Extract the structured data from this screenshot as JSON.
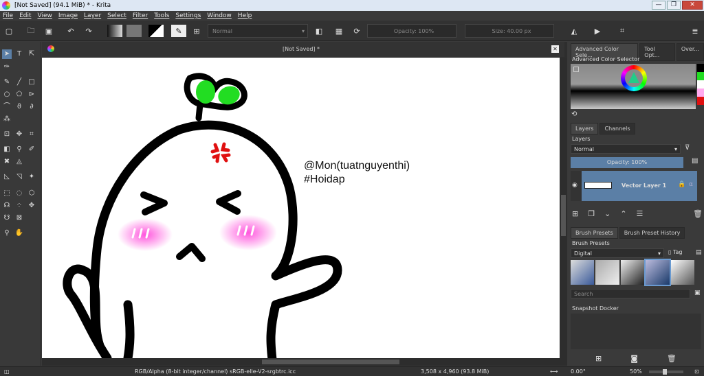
{
  "window": {
    "title": "[Not Saved]  (94.1 MiB)  * - Krita",
    "minimize": "—",
    "restore": "❐",
    "close": "✕"
  },
  "menu": [
    "File",
    "Edit",
    "View",
    "Image",
    "Layer",
    "Select",
    "Filter",
    "Tools",
    "Settings",
    "Window",
    "Help"
  ],
  "toolbar": {
    "blend_mode": "Normal",
    "opacity": "Opacity: 100%",
    "size": "Size: 40.00 px"
  },
  "document": {
    "tab_title": "[Not Saved]  *",
    "close": "✕"
  },
  "canvas": {
    "text_line1": "@Mon(tuatnguyenthi)",
    "text_line2": "#Hoidap"
  },
  "right_dock": {
    "top_tabs": [
      "Advanced Color Sele...",
      "Tool Opt...",
      "Over..."
    ],
    "color_selector_title": "Advanced Color Selector",
    "layers_tabs": [
      "Layers",
      "Channels"
    ],
    "layers_title": "Layers",
    "blend_mode": "Normal",
    "layer_opacity": "Opacity:  100%",
    "layer_name": "Vector Layer 1",
    "preset_tabs": [
      "Brush Presets",
      "Brush Preset History"
    ],
    "presets_title": "Brush Presets",
    "preset_filter": "Digital",
    "tag_label": "Tag",
    "search_placeholder": "Search",
    "snapshot_title": "Snapshot Docker"
  },
  "status": {
    "color_space": "RGB/Alpha (8-bit integer/channel)  sRGB-elle-V2-srgbtrc.icc",
    "dimensions": "3,508 x 4,960 (93.8 MiB)",
    "rotation": "0.00°",
    "zoom": "50%"
  },
  "colors": {
    "leaf_green": "#22dd22",
    "anger_red": "#e01010",
    "blush_pink": "#ff66e0",
    "layer_selected": "#5b7fa6"
  }
}
